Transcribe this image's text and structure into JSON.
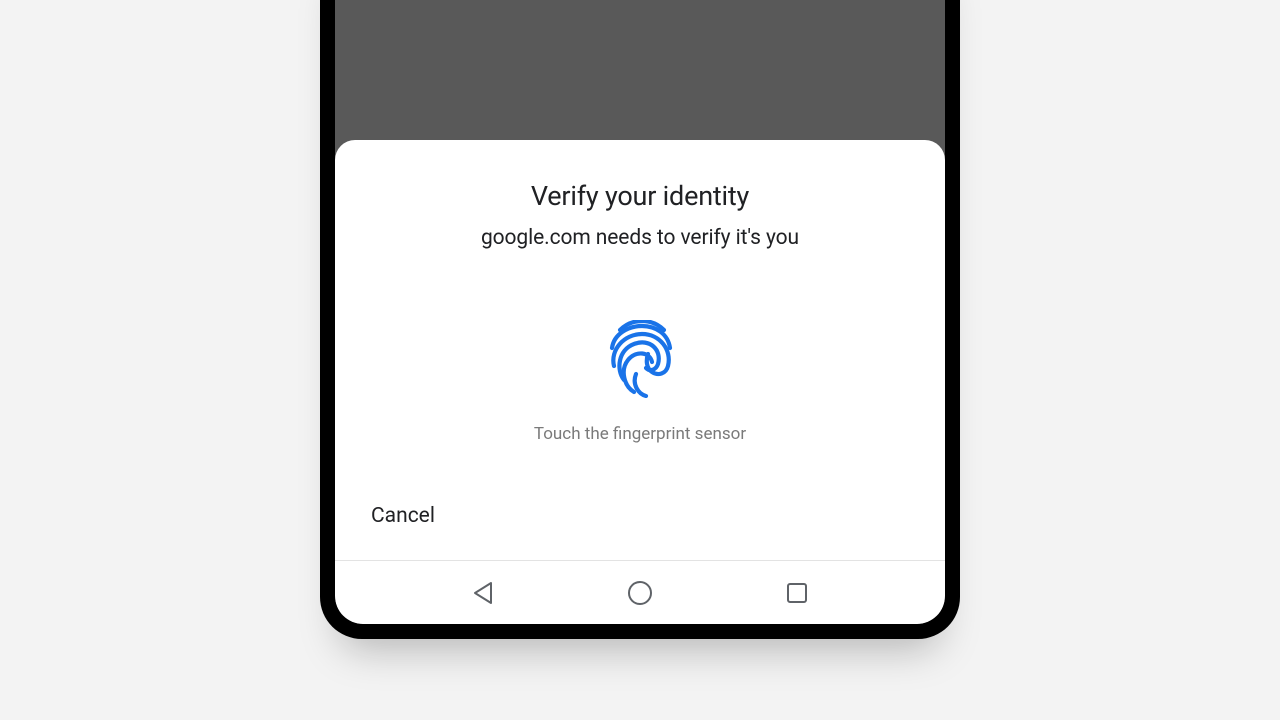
{
  "dialog": {
    "title": "Verify your identity",
    "subtitle": "google.com needs to verify it's you",
    "hint": "Touch the fingerprint sensor",
    "cancel": "Cancel"
  },
  "colors": {
    "accent": "#1a73e8"
  }
}
